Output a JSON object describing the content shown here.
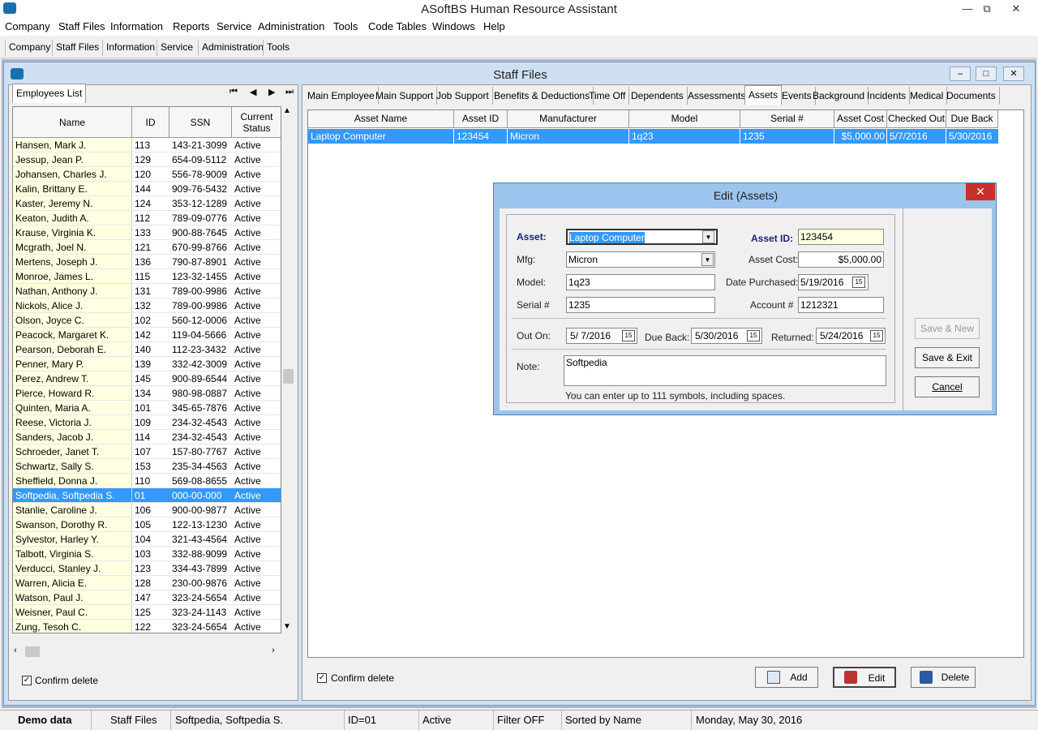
{
  "window": {
    "title": "ASoftBS Human Resource Assistant",
    "minimize": "—",
    "restore": "⧉",
    "close": "✕"
  },
  "menu": [
    "Company",
    "Staff Files",
    "Information",
    "Reports",
    "Service",
    "Administration",
    "Tools",
    "Code Tables",
    "Windows",
    "Help"
  ],
  "toolbar": [
    "Company",
    "Staff Files",
    "Information",
    "Service",
    "Administration",
    "Tools"
  ],
  "staff_files": {
    "title": "Staff Files",
    "left": {
      "tab": "Employees List",
      "nav": [
        "⏮",
        "◀",
        "▶",
        "⏭"
      ],
      "columns": [
        "Name",
        "ID",
        "SSN",
        "Current Status"
      ],
      "rows": [
        [
          "Hansen, Mark J.",
          "113",
          "143-21-3099",
          "Active"
        ],
        [
          "Jessup, Jean P.",
          "129",
          "654-09-5112",
          "Active"
        ],
        [
          "Johansen, Charles J.",
          "120",
          "556-78-9009",
          "Active"
        ],
        [
          "Kalin, Brittany E.",
          "144",
          "909-76-5432",
          "Active"
        ],
        [
          "Kaster, Jeremy N.",
          "124",
          "353-12-1289",
          "Active"
        ],
        [
          "Keaton, Judith A.",
          "112",
          "789-09-0776",
          "Active"
        ],
        [
          "Krause, Virginia K.",
          "133",
          "900-88-7645",
          "Active"
        ],
        [
          "Mcgrath, Joel N.",
          "121",
          "670-99-8766",
          "Active"
        ],
        [
          "Mertens, Joseph J.",
          "136",
          "790-87-8901",
          "Active"
        ],
        [
          "Monroe, James L.",
          "115",
          "123-32-1455",
          "Active"
        ],
        [
          "Nathan, Anthony J.",
          "131",
          "789-00-9986",
          "Active"
        ],
        [
          "Nickols, Alice J.",
          "132",
          "789-00-9986",
          "Active"
        ],
        [
          "Olson, Joyce C.",
          "102",
          "560-12-0006",
          "Active"
        ],
        [
          "Peacock, Margaret K.",
          "142",
          "119-04-5666",
          "Active"
        ],
        [
          "Pearson, Deborah E.",
          "140",
          "112-23-3432",
          "Active"
        ],
        [
          "Penner, Mary P.",
          "139",
          "332-42-3009",
          "Active"
        ],
        [
          "Perez, Andrew T.",
          "145",
          "900-89-6544",
          "Active"
        ],
        [
          "Pierce, Howard R.",
          "134",
          "980-98-0887",
          "Active"
        ],
        [
          "Quinten, Maria A.",
          "101",
          "345-65-7876",
          "Active"
        ],
        [
          "Reese, Victoria J.",
          "109",
          "234-32-4543",
          "Active"
        ],
        [
          "Sanders, Jacob J.",
          "114",
          "234-32-4543",
          "Active"
        ],
        [
          "Schroeder, Janet T.",
          "107",
          "157-80-7767",
          "Active"
        ],
        [
          "Schwartz, Sally S.",
          "153",
          "235-34-4563",
          "Active"
        ],
        [
          "Sheffield, Donna J.",
          "110",
          "569-08-8655",
          "Active"
        ],
        [
          "Softpedia, Softpedia S.",
          "01",
          "000-00-000",
          "Active"
        ],
        [
          "Stanlie, Caroline J.",
          "106",
          "900-00-9877",
          "Active"
        ],
        [
          "Swanson, Dorothy R.",
          "105",
          "122-13-1230",
          "Active"
        ],
        [
          "Sylvestor, Harley Y.",
          "104",
          "321-43-4564",
          "Active"
        ],
        [
          "Talbott, Virginia S.",
          "103",
          "332-88-9099",
          "Active"
        ],
        [
          "Verducci, Stanley J.",
          "123",
          "334-43-7899",
          "Active"
        ],
        [
          "Warren, Alicia E.",
          "128",
          "230-00-9876",
          "Active"
        ],
        [
          "Watson, Paul J.",
          "147",
          "323-24-5654",
          "Active"
        ],
        [
          "Weisner, Paul C.",
          "125",
          "323-24-1143",
          "Active"
        ],
        [
          "Zung, Tesoh C.",
          "122",
          "323-24-5654",
          "Active"
        ]
      ],
      "selected_index": 24,
      "confirm_delete": "Confirm delete"
    },
    "right": {
      "tabs": [
        "Main Employee",
        "Main Support",
        "Job Support",
        "Benefits & Deductions",
        "Time Off",
        "Dependents",
        "Assessments",
        "Assets",
        "Events",
        "Background",
        "Incidents",
        "Medical",
        "Documents"
      ],
      "active_tab": "Assets",
      "columns": [
        "Asset Name",
        "Asset ID",
        "Manufacturer",
        "Model",
        "Serial #",
        "Asset Cost",
        "Checked Out",
        "Due Back"
      ],
      "rows": [
        [
          "Laptop Computer",
          "123454",
          "Micron",
          "1q23",
          "1235",
          "$5,000.00",
          "5/7/2016",
          "5/30/2016"
        ]
      ],
      "confirm_delete": "Confirm delete",
      "buttons": {
        "add": "Add",
        "edit": "Edit",
        "delete": "Delete"
      }
    }
  },
  "dialog": {
    "title": "Edit (Assets)",
    "labels": {
      "asset": "Asset:",
      "asset_id": "Asset ID:",
      "mfg": "Mfg:",
      "asset_cost": "Asset Cost:",
      "model": "Model:",
      "date_purchased": "Date Purchased:",
      "serial": "Serial #",
      "account": "Account #",
      "out_on": "Out On:",
      "due_back": "Due Back:",
      "returned": "Returned:",
      "note": "Note:"
    },
    "values": {
      "asset": "Laptop Computer",
      "asset_id": "123454",
      "mfg": "Micron",
      "asset_cost": "$5,000.00",
      "model": "1q23",
      "date_purchased": "5/19/2016",
      "serial": "1235",
      "account": "1212321",
      "out_on": "5/ 7/2016",
      "due_back": "5/30/2016",
      "returned": "5/24/2016",
      "note": "Softpedia"
    },
    "hint": "You can enter up to 111 symbols, including spaces.",
    "buttons": {
      "save_new": "Save & New",
      "save_exit": "Save & Exit",
      "cancel": "Cancel"
    }
  },
  "status": {
    "mode": "Demo data",
    "section": "Staff Files",
    "employee": "Softpedia, Softpedia S.",
    "id": "ID=01",
    "state": "Active",
    "filter": "Filter OFF",
    "sort": "Sorted by Name",
    "date": "Monday, May 30, 2016"
  },
  "colors": {
    "selection": "#3399ff",
    "name_col": "#ffffe1",
    "dialog_frame": "#9cc4ec",
    "close": "#c7312a"
  }
}
